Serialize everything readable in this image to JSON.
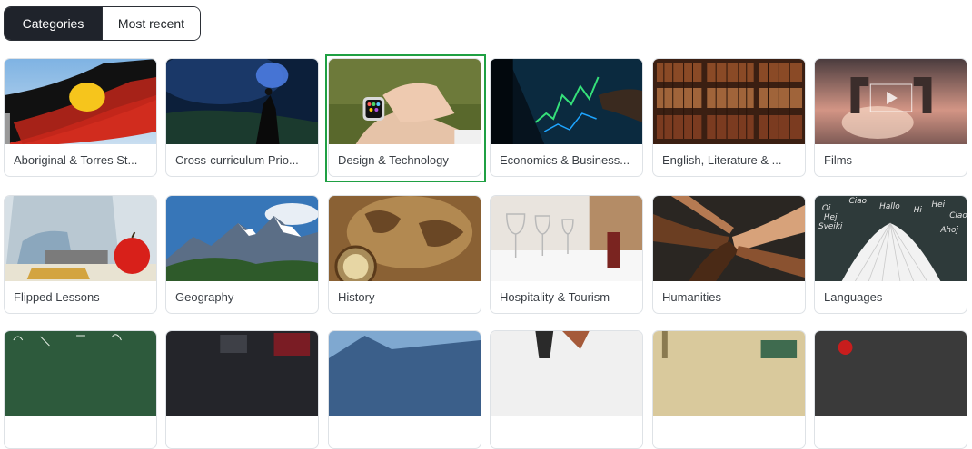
{
  "tabs": {
    "categories_label": "Categories",
    "recent_label": "Most recent"
  },
  "cards": [
    {
      "label": "Aboriginal & Torres St...",
      "image": "aboriginal-flag"
    },
    {
      "label": "Cross-curriculum Prio...",
      "image": "flare-night-hill"
    },
    {
      "label": "Design & Technology",
      "image": "smartwatch-hand"
    },
    {
      "label": "Economics & Business...",
      "image": "stock-chart-tablet"
    },
    {
      "label": "English, Literature & ...",
      "image": "library-bookshelf"
    },
    {
      "label": "Films",
      "image": "hands-frame-sunset"
    },
    {
      "label": "Flipped Lessons",
      "image": "student-tablet-apple"
    },
    {
      "label": "Geography",
      "image": "mountains-forest"
    },
    {
      "label": "History",
      "image": "old-map-compass"
    },
    {
      "label": "Hospitality & Tourism",
      "image": "restaurant-wine-glasses"
    },
    {
      "label": "Humanities",
      "image": "stacked-hands"
    },
    {
      "label": "Languages",
      "image": "open-book-chalkboard-greetings"
    }
  ],
  "chalk_words": [
    "Ciao",
    "Hallo",
    "Hi",
    "Hei",
    "Oi",
    "Hej",
    "Ciao",
    "Sveiki",
    "Ahoj"
  ],
  "selected_card": "Design & Technology"
}
